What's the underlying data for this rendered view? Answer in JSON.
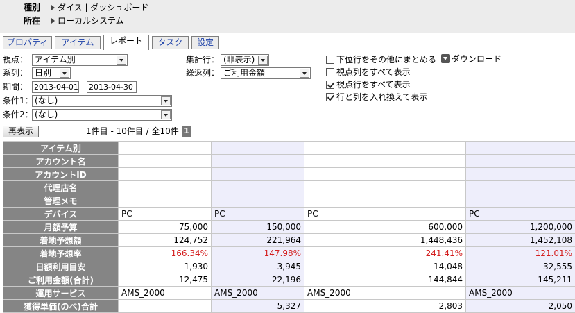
{
  "info": {
    "type_label": "種別",
    "type_value": "ダイス | ダッシュボード",
    "location_label": "所在",
    "location_value": "ローカルシステム"
  },
  "tabs": [
    "プロパティ",
    "アイテム",
    "レポート",
    "タスク",
    "設定"
  ],
  "controls": {
    "viewpoint_label": "視点：",
    "viewpoint_value": "アイテム別",
    "series_label": "系列：",
    "series_value": "日別",
    "period_label": "期間：",
    "period_start": "2013-04-01",
    "period_sep": "-",
    "period_end": "2013-04-30",
    "cond1_label": "条件1：",
    "cond1_value": "(なし)",
    "cond2_label": "条件2：",
    "cond2_value": "(なし)",
    "agg_label": "集計行：",
    "agg_value": "(非表示)",
    "repeat_label": "繰返列：",
    "repeat_value": "ご利用金額"
  },
  "options": [
    {
      "label": "下位行をその他にまとめる",
      "checked": false
    },
    {
      "label": "視点列をすべて表示",
      "checked": false
    },
    {
      "label": "視点行をすべて表示",
      "checked": true
    },
    {
      "label": "行と列を入れ換えて表示",
      "checked": true
    }
  ],
  "download_label": "ダウンロード",
  "redisplay_label": "再表示",
  "pager_text": "1件目 - 10件目 / 全10件",
  "current_page": "1",
  "table": {
    "rows": [
      {
        "label": "アイテム別",
        "cells": [
          "",
          "",
          "",
          ""
        ],
        "kind": "blank"
      },
      {
        "label": "アカウント名",
        "cells": [
          "",
          "",
          "",
          ""
        ],
        "kind": "blank"
      },
      {
        "label": "アカウントID",
        "cells": [
          "",
          "",
          "",
          ""
        ],
        "kind": "blank"
      },
      {
        "label": "代理店名",
        "cells": [
          "",
          "",
          "",
          ""
        ],
        "kind": "blank"
      },
      {
        "label": "管理メモ",
        "cells": [
          "",
          "",
          "",
          ""
        ],
        "kind": "text"
      },
      {
        "label": "デバイス",
        "cells": [
          "PC",
          "PC",
          "PC",
          "PC"
        ],
        "kind": "text"
      },
      {
        "label": "月額予算",
        "cells": [
          "75,000",
          "150,000",
          "600,000",
          "1,200,000"
        ],
        "kind": "num"
      },
      {
        "label": "着地予想額",
        "cells": [
          "124,752",
          "221,964",
          "1,448,436",
          "1,452,108"
        ],
        "kind": "num"
      },
      {
        "label": "着地予想率",
        "cells": [
          "166.34%",
          "147.98%",
          "241.41%",
          "121.01%"
        ],
        "kind": "red"
      },
      {
        "label": "日額利用目安",
        "cells": [
          "1,930",
          "3,945",
          "14,048",
          "32,555"
        ],
        "kind": "num"
      },
      {
        "label": "ご利用金額(合計)",
        "cells": [
          "12,475",
          "22,196",
          "144,844",
          "145,211"
        ],
        "kind": "num"
      },
      {
        "label": "運用サービス",
        "cells": [
          "AMS_2000",
          "AMS_2000",
          "AMS_2000",
          "AMS_2000"
        ],
        "kind": "text"
      },
      {
        "label": "獲得単価(のべ)合計",
        "cells": [
          "",
          "5,327",
          "2,803",
          "2,050"
        ],
        "kind": "num"
      }
    ]
  }
}
